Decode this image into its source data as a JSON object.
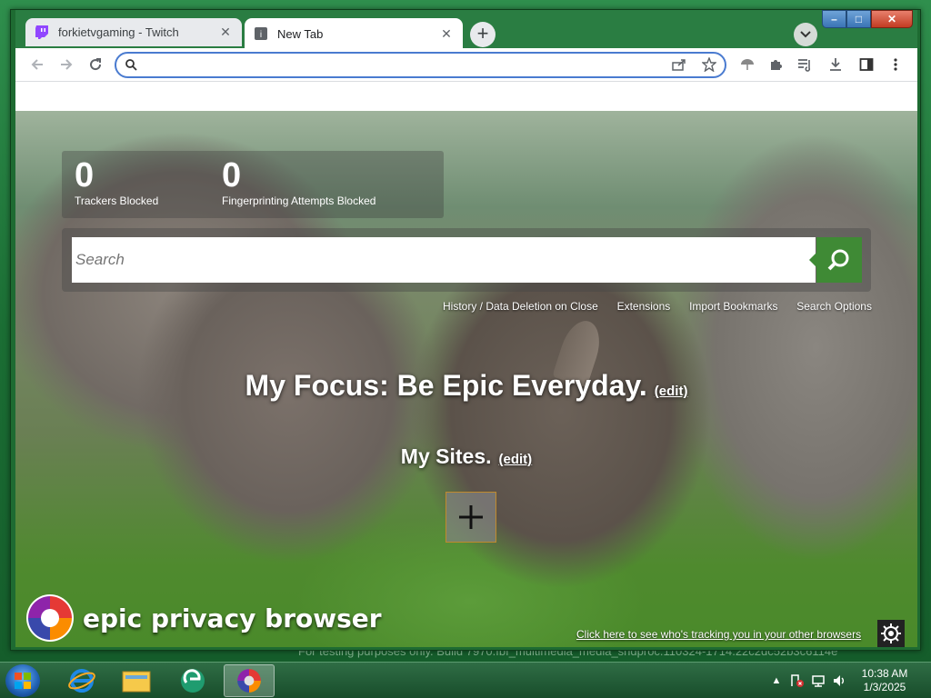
{
  "tabs": [
    {
      "title": "forkietvgaming - Twitch",
      "favicon": "twitch-icon",
      "active": false
    },
    {
      "title": "New Tab",
      "favicon": "epic-icon",
      "active": true
    }
  ],
  "omnibox": {
    "value": "",
    "placeholder": ""
  },
  "stats": [
    {
      "value": "0",
      "label": "Trackers Blocked"
    },
    {
      "value": "0",
      "label": "Fingerprinting Attempts Blocked"
    }
  ],
  "search": {
    "placeholder": "Search"
  },
  "links": [
    "History / Data Deletion on Close",
    "Extensions",
    "Import Bookmarks",
    "Search Options"
  ],
  "focus": {
    "text": "My Focus: Be Epic Everyday.",
    "edit": "(edit)"
  },
  "sites": {
    "title": "My Sites.",
    "edit": "(edit)"
  },
  "brand": "epic privacy browser",
  "tracking_link": "Click here to see who's tracking you in your other browsers",
  "watermark": "For testing purposes only. Build 7970.fbf_multimedia_media_sndproc.110324-1714.22c2dc52b3c6114e",
  "clock": {
    "time": "10:38 AM",
    "date": "1/3/2025"
  },
  "colors": {
    "accent": "#3f8a35",
    "omnibox_border": "#4a7bd0"
  }
}
